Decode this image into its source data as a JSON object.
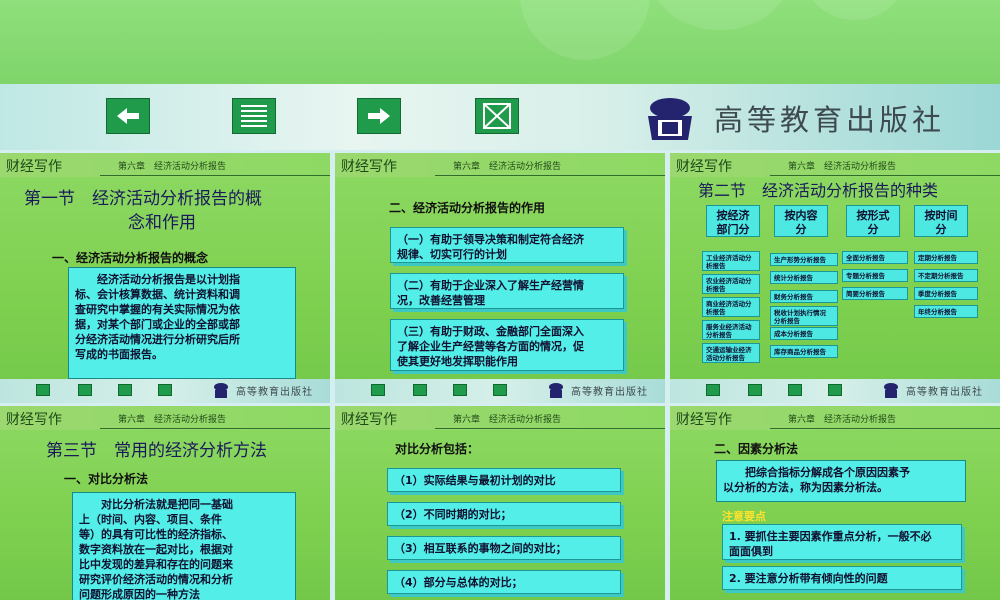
{
  "publisher": "高等教育出版社",
  "colors": {
    "slide_green": "#7ed04f",
    "accent_cyan": "#53eee8",
    "button_green": "#1f9b4b",
    "note_yellow": "#ffe12e"
  },
  "nav": {
    "prev_icon": "left-arrow-icon",
    "menu_icon": "menu-lines-icon",
    "next_icon": "right-arrow-icon",
    "close_icon": "close-x-icon"
  },
  "slide_common": {
    "brand": "财经写作",
    "chapter": "第六章　经济活动分析报告",
    "publisher": "高等教育出版社"
  },
  "slides": [
    {
      "title_l1": "第一节　经济活动分析报告的概",
      "title_l2": "念和作用",
      "subtitle": "一、经济活动分析报告的概念",
      "scroll": [
        "　　经济活动分析报告是以计划指",
        "标、会计核算数据、统计资料和调",
        "查研究中掌握的有关实际情况为依",
        "据，对某个部门或企业的全部或部",
        "分经济活动情况进行分析研究后所",
        "写成的书面报告。"
      ]
    },
    {
      "subtitle": "二、经济活动分析报告的作用",
      "boxes": [
        [
          "（一）有助于领导决策和制定符合经济",
          "规律、切实可行的计划"
        ],
        [
          "（二）有助于企业深入了解生产经营情",
          "况，改善经营管理"
        ],
        [
          "（三）有助于财政、金融部门全面深入",
          "了解企业生产经营等各方面的情况，促",
          "使其更好地发挥职能作用"
        ]
      ]
    },
    {
      "title": "第二节　经济活动分析报告的种类",
      "cats": [
        [
          "按经济",
          "部门分"
        ],
        [
          "按内容",
          "分"
        ],
        [
          "按形式",
          "分"
        ],
        [
          "按时间",
          "分"
        ]
      ],
      "col1": [
        [
          "工业经济活动分",
          "析报告"
        ],
        [
          "农业经济活动分",
          "析报告"
        ],
        [
          "商业经济活动分",
          "析报告"
        ],
        [
          "服务业经济活动",
          "分析报告"
        ],
        [
          "交通运输业经济",
          "活动分析报告"
        ]
      ],
      "col2": [
        [
          "生产形势分析报告"
        ],
        [
          "统计分析报告"
        ],
        [
          "财务分析报告"
        ],
        [
          "税收计划执行情况",
          "分析报告"
        ],
        [
          "成本分析报告"
        ],
        [
          "库存商品分析报告"
        ]
      ],
      "col3": [
        "全面分析报告",
        "专题分析报告",
        "简要分析报告"
      ],
      "col4": [
        "定期分析报告",
        "不定期分析报告",
        "季度分析报告",
        "年终分析报告"
      ]
    },
    {
      "title": "第三节　常用的经济分析方法",
      "subtitle": "一、对比分析法",
      "scroll": [
        "　　对比分析法就是把同一基础",
        "上（时间、内容、项目、条件",
        "等）的具有可比性的经济指标、",
        "数字资料放在一起对比，根据对",
        "比中发现的差异和存在的问题来",
        "研究评价经济活动的情况和分析",
        "问题形成原因的一种方法"
      ]
    },
    {
      "subtitle": "对比分析包括：",
      "items": [
        "（1）实际结果与最初计划的对比",
        "（2）不同时期的对比；",
        "（3）相互联系的事物之间的对比；",
        "（4）部分与总体的对比；"
      ]
    },
    {
      "subtitle": "二、因素分析法",
      "scroll": [
        "　　把综合指标分解成各个原因因素予",
        "以分析的方法，称为因素分析法。"
      ],
      "note": "注意要点",
      "points": [
        [
          "1. 要抓住主要因素作重点分析，一般不必",
          "面面俱到"
        ],
        [
          "2. 要注意分析带有倾向性的问题"
        ]
      ]
    }
  ]
}
